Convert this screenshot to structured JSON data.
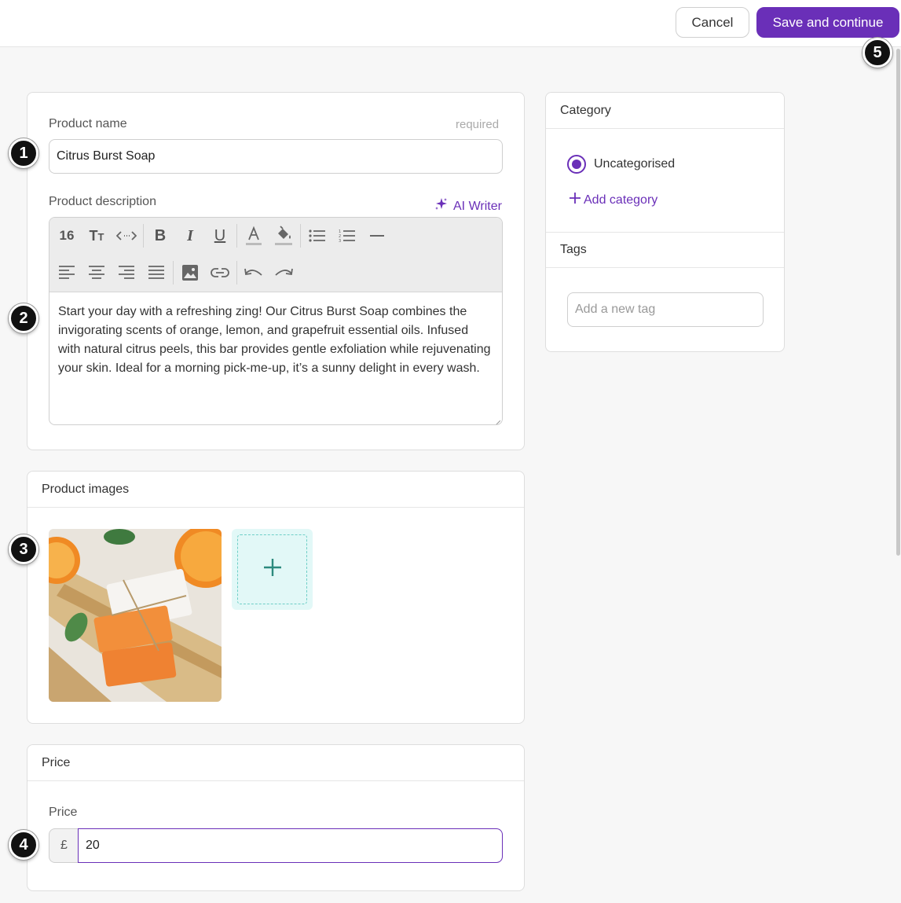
{
  "topbar": {
    "cancel_label": "Cancel",
    "save_label": "Save and continue",
    "accent": "#6a2fb8"
  },
  "markers": [
    "1",
    "2",
    "3",
    "4",
    "5"
  ],
  "product": {
    "name_label": "Product name",
    "required_label": "required",
    "name_value": "Citrus Burst Soap",
    "description_label": "Product description",
    "ai_writer_label": "AI Writer",
    "font_size": "16",
    "description_value": "Start your day with a refreshing zing! Our Citrus Burst Soap combines the invigorating scents of orange, lemon, and grapefruit essential oils. Infused with natural citrus peels, this bar provides gentle exfoliation while rejuvenating your skin. Ideal for a morning pick-me-up, it’s a sunny delight in every wash."
  },
  "toolbar_icons": {
    "row1": [
      "font-size",
      "text-style-icon",
      "code-icon",
      "bold-icon",
      "italic-icon",
      "underline-icon",
      "text-color-icon",
      "highlight-color-icon",
      "bullet-list-icon",
      "numbered-list-icon",
      "horizontal-rule-icon"
    ],
    "row2": [
      "align-left-icon",
      "align-center-icon",
      "align-right-icon",
      "align-justify-icon",
      "image-icon",
      "link-icon",
      "undo-icon",
      "redo-icon"
    ]
  },
  "images": {
    "title": "Product images",
    "add_icon": "plus-icon"
  },
  "price": {
    "title": "Price",
    "label": "Price",
    "currency": "£",
    "value": "20"
  },
  "category": {
    "title": "Category",
    "selected": "Uncategorised",
    "add_label": "Add category"
  },
  "tags": {
    "title": "Tags",
    "placeholder": "Add a new tag"
  }
}
